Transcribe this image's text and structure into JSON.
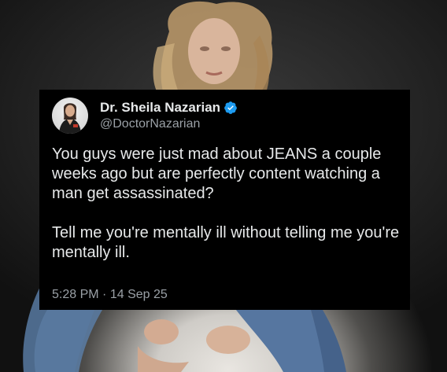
{
  "tweet": {
    "display_name": "Dr. Sheila Nazarian",
    "handle": "@DoctorNazarian",
    "verified": true,
    "paragraphs": [
      "You guys were just mad about JEANS a couple weeks ago but are perfectly content watching a man get assassinated?",
      "Tell me you're mentally ill without telling me you're mentally ill."
    ],
    "time": "5:28 PM",
    "separator": "·",
    "date": "14 Sep 25"
  },
  "colors": {
    "card_background": "#000000",
    "primary_text": "#e7e9ea",
    "secondary_text": "#9aa0a6",
    "verified_badge": "#1d9bf0"
  },
  "icons": {
    "verified": "verified-badge-icon",
    "avatar": "profile-avatar"
  }
}
